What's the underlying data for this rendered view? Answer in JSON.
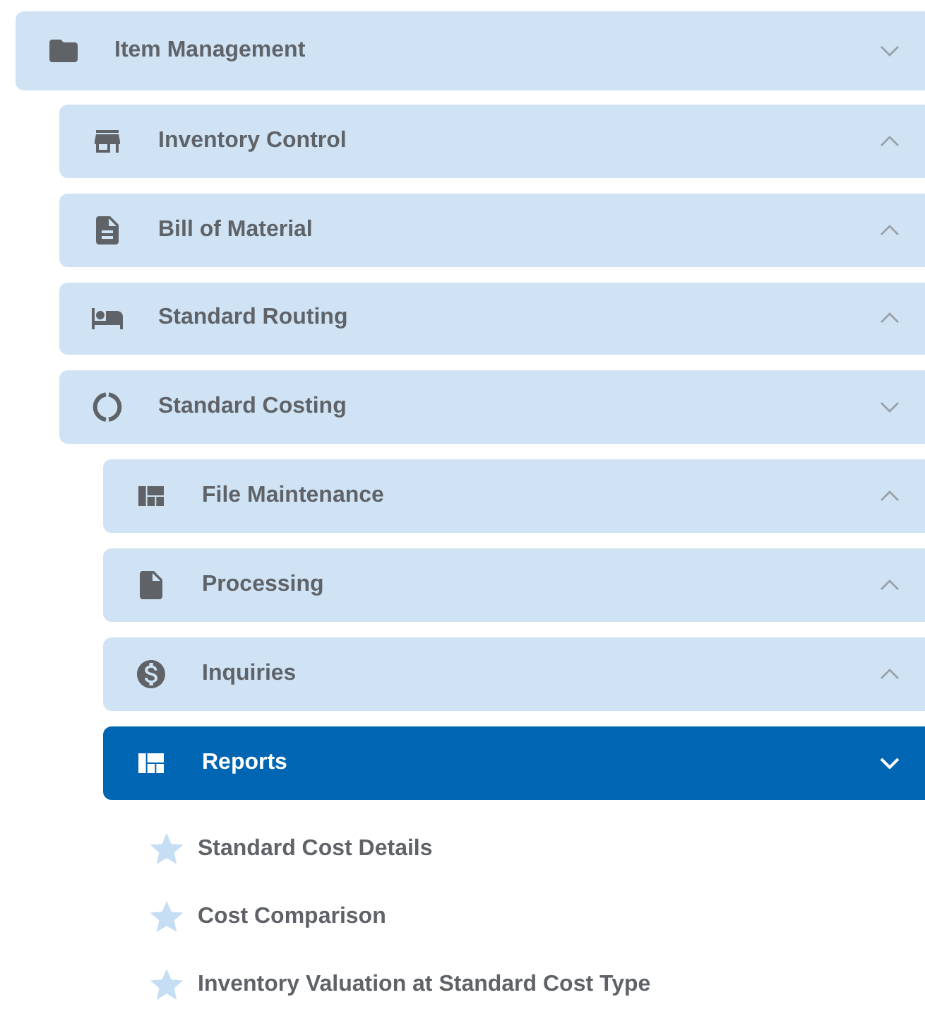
{
  "menu": [
    {
      "kind": "group",
      "label": "Item Management",
      "expanded": true,
      "selected": false,
      "children": [
        {
          "kind": "group",
          "label": "Inventory Control",
          "expanded": false,
          "selected": false
        },
        {
          "kind": "group",
          "label": "Bill of Material",
          "expanded": false,
          "selected": false
        },
        {
          "kind": "group",
          "label": "Standard Routing",
          "expanded": false,
          "selected": false
        },
        {
          "kind": "group",
          "label": "Standard Costing",
          "expanded": true,
          "selected": false,
          "children": [
            {
              "kind": "group",
              "label": "File Maintenance",
              "expanded": false,
              "selected": false
            },
            {
              "kind": "group",
              "label": "Processing",
              "expanded": false,
              "selected": false
            },
            {
              "kind": "group",
              "label": "Inquiries",
              "expanded": false,
              "selected": false
            },
            {
              "kind": "group",
              "label": "Reports",
              "expanded": true,
              "selected": true,
              "children": [
                {
                  "kind": "link",
                  "label": "Standard Cost Details"
                },
                {
                  "kind": "link",
                  "label": "Cost Comparison"
                },
                {
                  "kind": "link",
                  "label": "Inventory Valuation at Standard Cost Type"
                }
              ]
            }
          ]
        }
      ]
    }
  ]
}
